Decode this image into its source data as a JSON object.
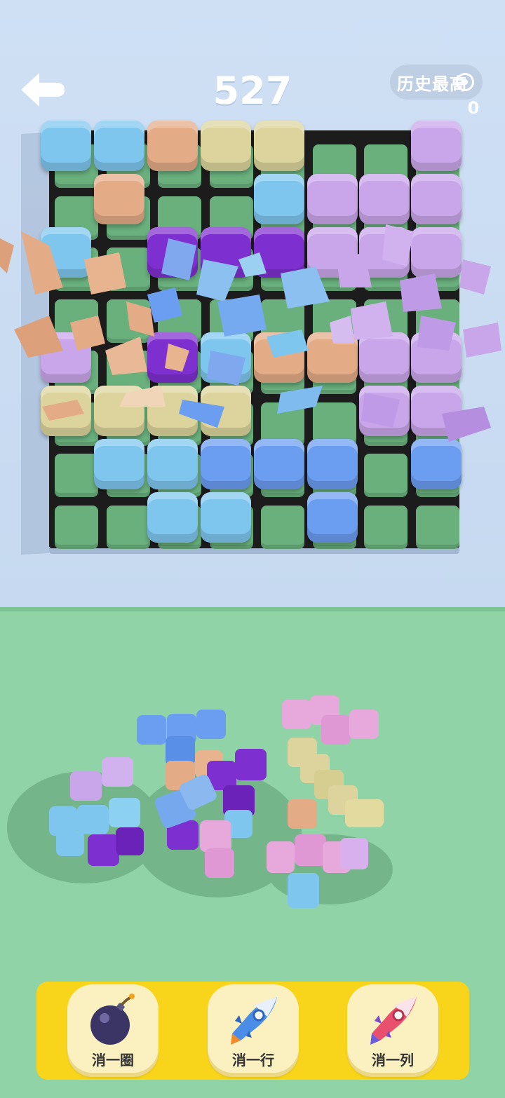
{
  "header": {
    "score": "527",
    "best_label": "历史最高",
    "best_value": "0"
  },
  "tools": [
    {
      "label": "消一圈",
      "icon": "bomb-icon"
    },
    {
      "label": "消一行",
      "icon": "rocket-horizontal-icon"
    },
    {
      "label": "消一列",
      "icon": "rocket-vertical-icon"
    }
  ],
  "colors": {
    "sky_blue": "#7ec6ee",
    "blue": "#6b9df0",
    "peach": "#e3ab86",
    "cream": "#dcd49c",
    "lavender": "#c9a6ea",
    "purple": "#7e2fcf",
    "pink": "#e7a8dc",
    "empty_cell": "#69b07d"
  }
}
